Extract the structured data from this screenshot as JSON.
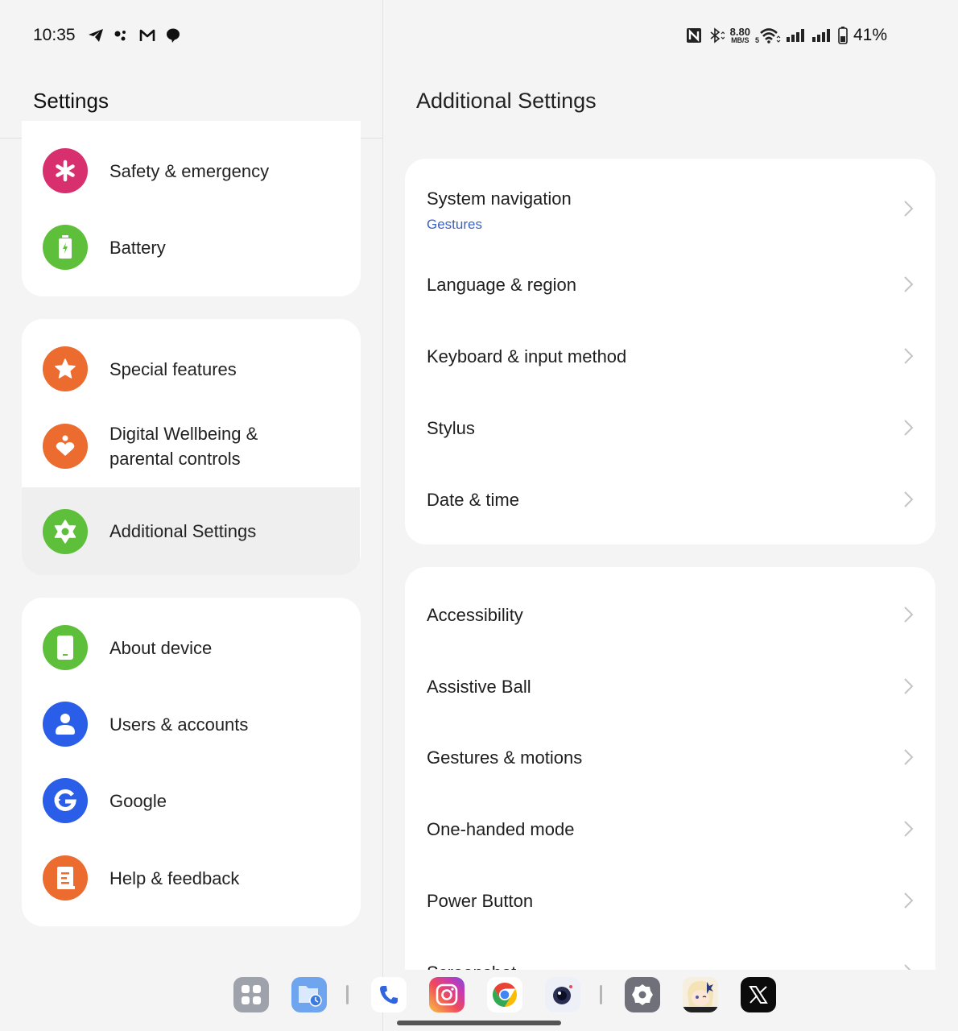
{
  "status_bar": {
    "time": "10:35",
    "left_icons": [
      "telegram-icon",
      "assistant-dots-icon",
      "gmail-icon",
      "chat-bubble-icon"
    ],
    "right_icons": [
      "nfc-icon",
      "bluetooth-icon",
      "wifi-icon",
      "signal-icon",
      "signal-icon",
      "battery-icon"
    ],
    "net_speed_value": "8.80",
    "net_speed_unit": "MB/S",
    "wifi_badge": "5",
    "battery_percent": "41%"
  },
  "left_pane": {
    "title": "Settings",
    "groups": [
      {
        "items": [
          {
            "label": "Safety & emergency",
            "icon": "asterisk-icon",
            "color": "#d8306e"
          },
          {
            "label": "Battery",
            "icon": "battery-icon",
            "color": "#5ec03a"
          }
        ]
      },
      {
        "items": [
          {
            "label": "Special features",
            "icon": "star-icon",
            "color": "#ec6b2f"
          },
          {
            "label": "Digital Wellbeing &",
            "label_line2": "parental controls",
            "icon": "wellbeing-heart-icon",
            "color": "#ec6b2f"
          },
          {
            "label": "Additional Settings",
            "icon": "gear-icon",
            "color": "#5ec03a",
            "selected": true
          }
        ]
      },
      {
        "items": [
          {
            "label": "About device",
            "icon": "phone-device-icon",
            "color": "#5ec03a"
          },
          {
            "label": "Users & accounts",
            "icon": "user-icon",
            "color": "#2a5ee8"
          },
          {
            "label": "Google",
            "icon": "google-icon",
            "color": "#2a5ee8"
          },
          {
            "label": "Help & feedback",
            "icon": "help-book-icon",
            "color": "#ec6b2f"
          }
        ]
      }
    ]
  },
  "right_pane": {
    "title": "Additional Settings",
    "groups": [
      {
        "items": [
          {
            "label": "System navigation",
            "subtitle": "Gestures"
          },
          {
            "label": "Language & region"
          },
          {
            "label": "Keyboard & input method"
          },
          {
            "label": "Stylus"
          },
          {
            "label": "Date & time"
          }
        ]
      },
      {
        "items": [
          {
            "label": "Accessibility"
          },
          {
            "label": "Assistive Ball"
          },
          {
            "label": "Gestures & motions"
          },
          {
            "label": "One-handed mode"
          },
          {
            "label": "Power Button"
          },
          {
            "label": "Screenshot"
          }
        ]
      }
    ],
    "subtitle_color": "#3a63c6"
  },
  "dock": {
    "apps": [
      "app-drawer",
      "file-manager",
      "phone",
      "instagram",
      "chrome",
      "camera",
      "settings",
      "genshin-game",
      "x"
    ]
  }
}
